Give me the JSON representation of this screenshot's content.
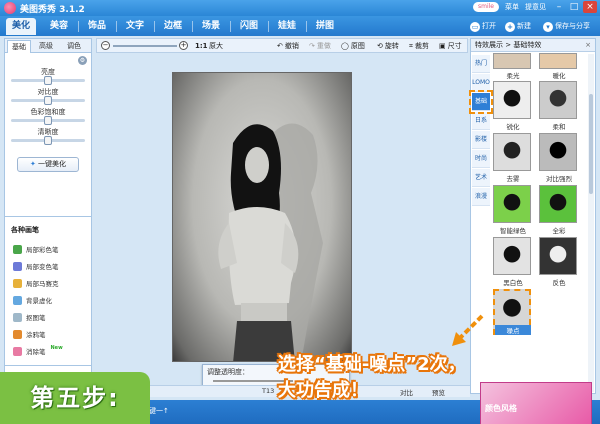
{
  "titlebar": {
    "title": "美图秀秀 3.1.2",
    "user": "smile",
    "menu": "菜单",
    "feedback": "提意见"
  },
  "tabs": [
    "美化",
    "美容",
    "饰品",
    "文字",
    "边框",
    "场景",
    "闪图",
    "娃娃",
    "拼图"
  ],
  "topbuttons": {
    "open": "打开",
    "new": "新建",
    "save": "保存与分享"
  },
  "left": {
    "subtabs": [
      "基础",
      "高级",
      "调色"
    ],
    "sliders": [
      {
        "label": "亮度",
        "value": 0.5
      },
      {
        "label": "对比度",
        "value": 0.5
      },
      {
        "label": "色彩饱和度",
        "value": 0.5
      },
      {
        "label": "清晰度",
        "value": 0.5
      }
    ],
    "onekey": "一键美化",
    "brush_title": "各种画笔",
    "brushes": [
      {
        "label": "局部彩色笔",
        "color": "#4aa64a"
      },
      {
        "label": "局部变色笔",
        "color": "#6d7ad8"
      },
      {
        "label": "局部马赛克",
        "color": "#e7b13a"
      },
      {
        "label": "背景虚化",
        "color": "#64a8e0"
      },
      {
        "label": "抠图笔",
        "color": "#9fb8c9"
      },
      {
        "label": "涂鸦笔",
        "color": "#e38a2e"
      },
      {
        "label": "消除笔",
        "color": "#e87aa3"
      }
    ],
    "new_badge": "New"
  },
  "toolbar": {
    "ratio": "1:1",
    "original_size": "原大",
    "undo": "撤销",
    "redo": "重做",
    "original": "原图",
    "rotate": "旋转",
    "crop": "裁剪",
    "size": "尺寸"
  },
  "dialog": {
    "label": "调整透明度：",
    "close": "×",
    "value": 1.0
  },
  "status": {
    "item1": "T13",
    "contrast": "对比",
    "preview": "预览"
  },
  "footer": {
    "text": "一键一↑"
  },
  "right": {
    "header": "特效展示 > 基础特效",
    "categories": [
      "热门",
      "LOMO",
      "基础",
      "日系",
      "影楼",
      "时尚",
      "艺术",
      "浪漫"
    ],
    "active_category": "基础",
    "effects": [
      "柔光",
      "暖化",
      "锐化",
      "柔和",
      "去雾",
      "对比强烈",
      "智能绿色",
      "全彩",
      "黑白色",
      "反色",
      "噪点"
    ],
    "selected_effect": "噪点"
  },
  "annotation": {
    "step": "第五步:",
    "caption_line1": "选择“基础-噪点”2次，",
    "caption_line2": "大功告成！"
  },
  "ad": {
    "text": "颜色风格"
  },
  "colors": {
    "accent": "#2379cd",
    "step_green": "#7bc043",
    "highlight_orange": "#f0900c"
  }
}
